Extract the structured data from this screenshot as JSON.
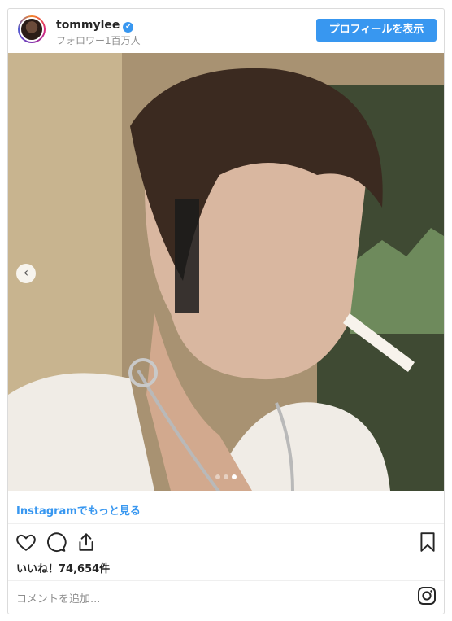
{
  "header": {
    "username": "tommylee",
    "verified_mark": "✔",
    "followers": "フォロワー1百万人",
    "profile_button": "プロフィールを表示"
  },
  "photo": {
    "icon": "photo",
    "carousel": {
      "prev_arrow": "‹",
      "dot_count": 3,
      "active_dot_index": 2
    }
  },
  "link": {
    "more_on_instagram": "Instagramでもっと見る"
  },
  "actions": {
    "icons": [
      "heart-icon",
      "comment-icon",
      "share-icon",
      "bookmark-icon"
    ]
  },
  "likes": "いいね！74,654件",
  "comment": {
    "placeholder": "コメントを追加..."
  },
  "colors": {
    "accent": "#3897f0",
    "border": "#dbdbdb",
    "muted": "#8e8e8e"
  }
}
